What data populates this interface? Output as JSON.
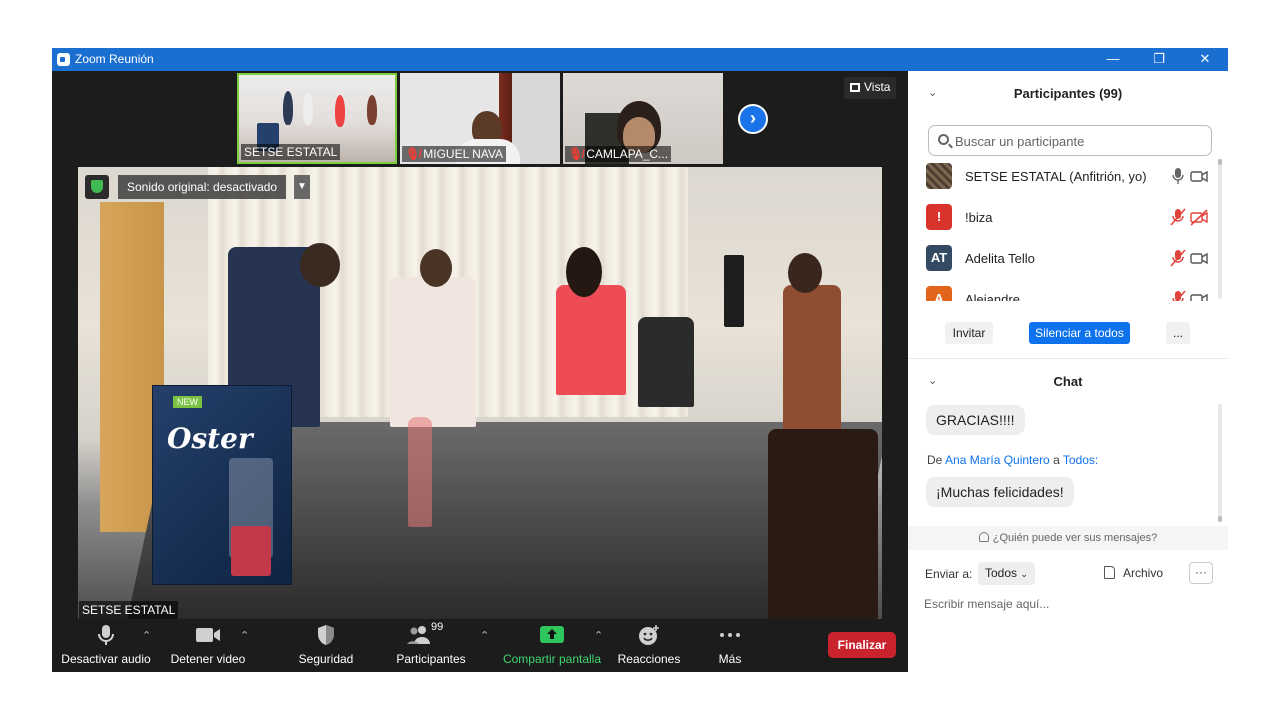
{
  "window": {
    "title": "Zoom Reunión",
    "icon": "zoom-camera-icon",
    "controls": [
      "minimize-icon",
      "maximize-icon",
      "close-icon"
    ]
  },
  "meeting": {
    "thumbnails": [
      {
        "name": "SETSE ESTATAL",
        "muted": false,
        "active": true
      },
      {
        "name": "MIGUEL NAVA",
        "muted": true,
        "active": false
      },
      {
        "name": "CAMLAPA_C...",
        "muted": true,
        "active": false
      }
    ],
    "view_button": "Vista",
    "sound_original": "Sonido original: desactivado",
    "main_speaker": "SETSE ESTATAL",
    "box_brand": "Oster",
    "box_new": "NEW"
  },
  "toolbar": {
    "audio_label": "Desactivar audio",
    "video_label": "Detener video",
    "security_label": "Seguridad",
    "participants_label": "Participantes",
    "participants_count": "99",
    "share_label": "Compartir pantalla",
    "reactions_label": "Reacciones",
    "more_label": "Más",
    "end_label": "Finalizar",
    "accent_green": "#3fd66f",
    "end_color": "#c9232d"
  },
  "participants": {
    "title": "Participantes (99)",
    "search_placeholder": "Buscar un participante",
    "list": [
      {
        "name": "SETSE ESTATAL (Anfitrión, yo)",
        "avatar": "",
        "avatar_color": "#6b5a45",
        "mic_muted": false,
        "cam_off": false
      },
      {
        "name": "!biza",
        "avatar": "!",
        "avatar_color": "#d9342b",
        "mic_muted": true,
        "cam_off": true
      },
      {
        "name": "Adelita Tello",
        "avatar": "AT",
        "avatar_color": "#344a63",
        "mic_muted": true,
        "cam_off": false
      },
      {
        "name": "Alejandre",
        "avatar": "A",
        "avatar_color": "#e2651b",
        "mic_muted": true,
        "cam_off": false
      }
    ],
    "invite_label": "Invitar",
    "mute_all_label": "Silenciar a todos",
    "more_label": "...",
    "accent_blue": "#0e72ed"
  },
  "chat": {
    "title": "Chat",
    "messages": [
      {
        "text": "GRACIAS!!!!"
      },
      {
        "from_prefix": "De",
        "from": "Ana María Quintero",
        "to_word": "a",
        "to": "Todos:",
        "text": "¡Muchas felicidades!"
      }
    ],
    "who_sees": "¿Quién puede ver sus mensajes?",
    "send_to_label": "Enviar a:",
    "send_to_value": "Todos",
    "file_label": "Archivo",
    "more_label": "···",
    "input_placeholder": "Escribir mensaje aquí..."
  }
}
